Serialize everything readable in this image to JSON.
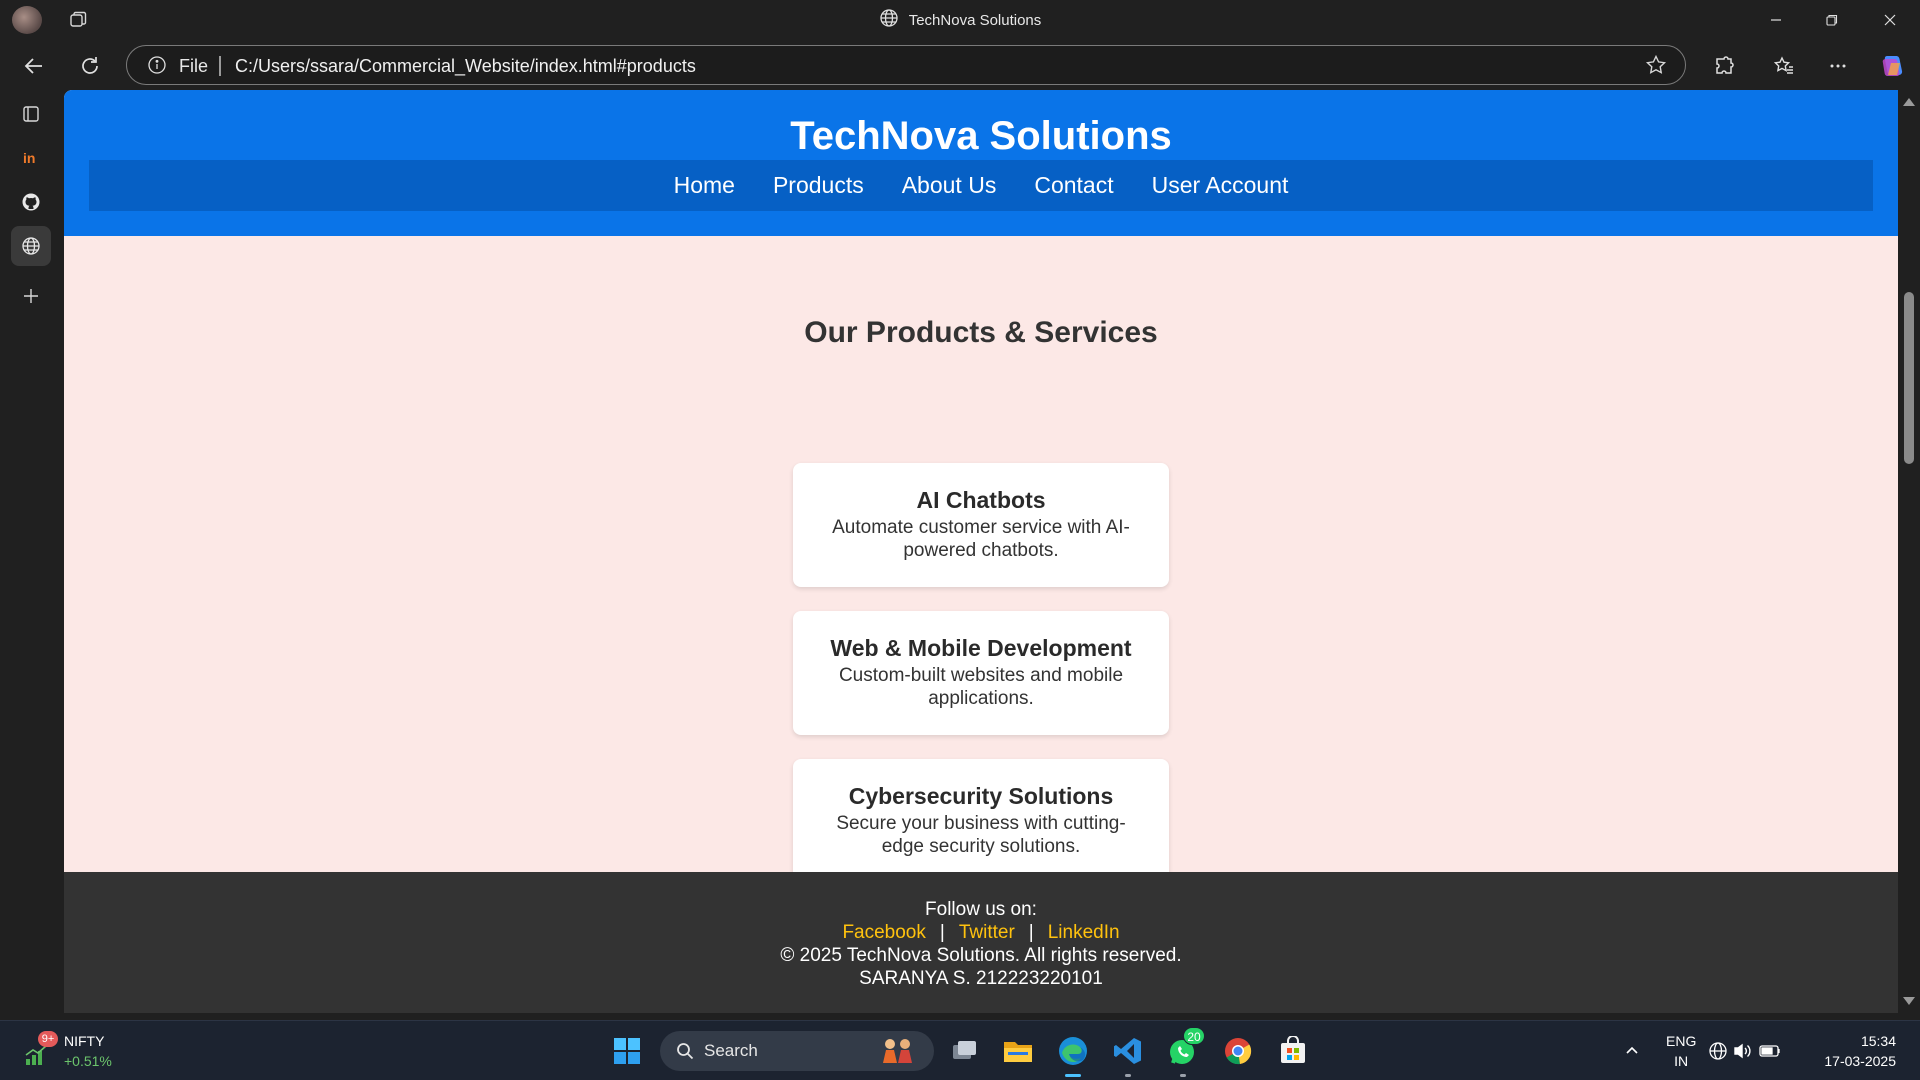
{
  "browser": {
    "window_title": "TechNova Solutions",
    "address": {
      "scheme_label": "File",
      "url": "C:/Users/ssara/Commercial_Website/index.html#products"
    }
  },
  "site": {
    "title": "TechNova Solutions",
    "nav": [
      "Home",
      "Products",
      "About Us",
      "Contact",
      "User Account"
    ],
    "products": {
      "heading": "Our Products & Services",
      "cards": [
        {
          "title": "AI Chatbots",
          "desc": "Automate customer service with AI-powered chatbots."
        },
        {
          "title": "Web & Mobile Development",
          "desc": "Custom-built websites and mobile applications."
        },
        {
          "title": "Cybersecurity Solutions",
          "desc": "Secure your business with cutting-edge security solutions."
        }
      ]
    },
    "footer": {
      "follow": "Follow us on:",
      "links": [
        "Facebook",
        "Twitter",
        "LinkedIn"
      ],
      "separator": "|",
      "copyright": "© 2025 TechNova Solutions. All rights reserved.",
      "author": "SARANYA S. 212223220101"
    }
  },
  "taskbar": {
    "nifty": {
      "badge": "9+",
      "label": "NIFTY",
      "change": "+0.51%"
    },
    "search_label": "Search",
    "whatsapp_badge": "20",
    "lang": {
      "line1": "ENG",
      "line2": "IN"
    },
    "clock": {
      "time": "15:34",
      "date": "17-03-2025"
    }
  },
  "colors": {
    "header_blue": "#0a74e8",
    "nav_blue": "#0660c5",
    "page_bg": "#fce8e6",
    "footer_bg": "#333333",
    "footer_link": "#ffc20e"
  }
}
